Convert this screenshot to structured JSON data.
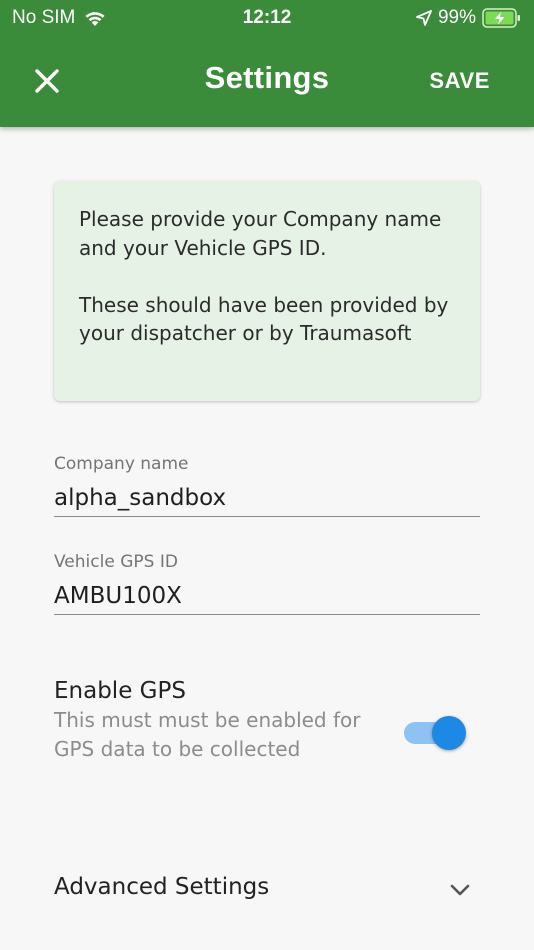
{
  "status_bar": {
    "carrier": "No SIM",
    "time": "12:12",
    "battery_percent": "99%",
    "wifi_icon": "wifi-icon",
    "location_icon": "location-arrow-icon",
    "battery_icon": "battery-charging-icon"
  },
  "appbar": {
    "title": "Settings",
    "save_label": "SAVE",
    "close_icon": "close-icon",
    "color": "#3a8c3a"
  },
  "info_card": {
    "paragraph1": "Please provide your Company name and your Vehicle GPS ID.",
    "paragraph2": "These should have been provided by your dispatcher or by Traumasoft",
    "background": "#e6f2e6"
  },
  "company_field": {
    "label": "Company name",
    "value": "alpha_sandbox"
  },
  "vehicle_field": {
    "label": "Vehicle GPS ID",
    "value": "AMBU100X"
  },
  "gps": {
    "title": "Enable GPS",
    "description": "This must must be enabled for GPS data to be collected",
    "enabled": true,
    "switch_color": "#1e88e5"
  },
  "advanced": {
    "label": "Advanced Settings",
    "icon": "chevron-down-icon"
  }
}
